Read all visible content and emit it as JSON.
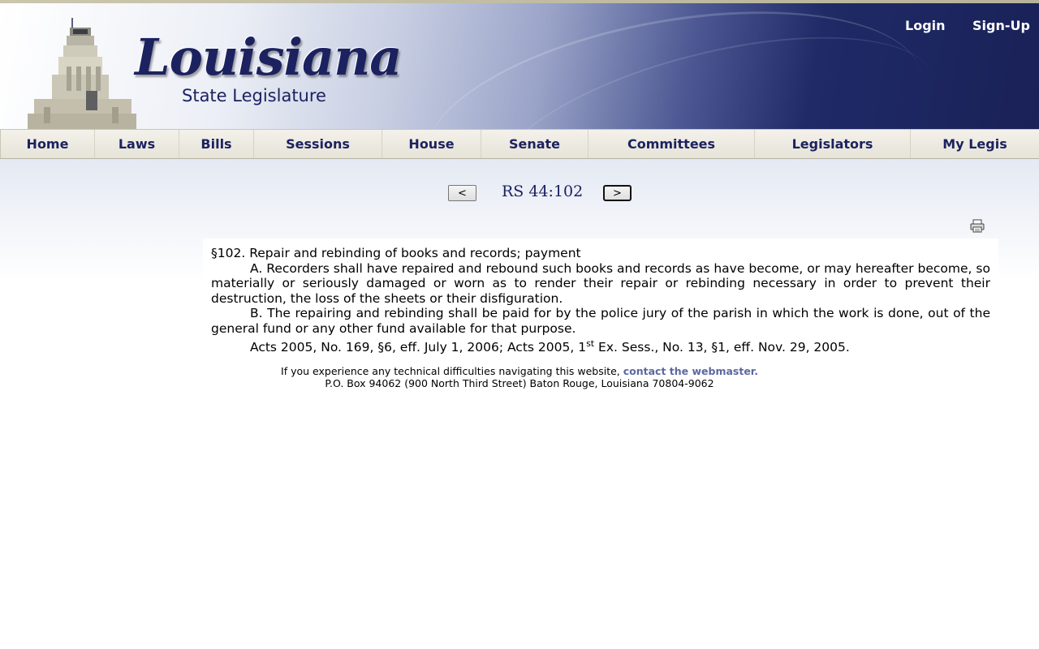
{
  "header": {
    "logo_title": "Louisiana",
    "logo_subtitle": "State Legislature",
    "login_label": "Login",
    "signup_label": "Sign-Up"
  },
  "nav": {
    "items": [
      {
        "label": "Home"
      },
      {
        "label": "Laws"
      },
      {
        "label": "Bills"
      },
      {
        "label": "Sessions"
      },
      {
        "label": "House"
      },
      {
        "label": "Senate"
      },
      {
        "label": "Committees"
      },
      {
        "label": "Legislators"
      },
      {
        "label": "My Legis"
      }
    ]
  },
  "pager": {
    "prev_label": "<",
    "next_label": ">",
    "title": "RS 44:102"
  },
  "law": {
    "heading": "§102.  Repair and rebinding of books and records; payment",
    "para_a": "A.  Recorders shall have repaired and rebound such books and records as have become, or may hereafter become, so materially or seriously damaged or worn as to render their repair or rebinding necessary in order to prevent their destruction, the loss of the sheets or their disfiguration.",
    "para_b": "B.  The repairing and rebinding shall be paid for by the police jury of the parish in which the work is done, out of the general fund or any other fund available for that purpose.",
    "history_part1": "Acts 2005, No. 169, §6, eff. July 1, 2006; Acts 2005, 1",
    "history_sup": "st",
    "history_part2": " Ex. Sess., No. 13, §1, eff. Nov. 29, 2005."
  },
  "footer": {
    "difficulty_text": "If you experience any technical difficulties navigating this website, ",
    "webmaster_link": "contact the webmaster.",
    "address": "P.O. Box 94062 (900 North Third Street) Baton Rouge, Louisiana 70804-9062"
  },
  "icons": {
    "print": "printer-icon",
    "capitol": "capitol-building-image"
  },
  "colors": {
    "brand_navy": "#1c2260",
    "link": "#5b68a0",
    "nav_bg": "#ebe8de"
  }
}
